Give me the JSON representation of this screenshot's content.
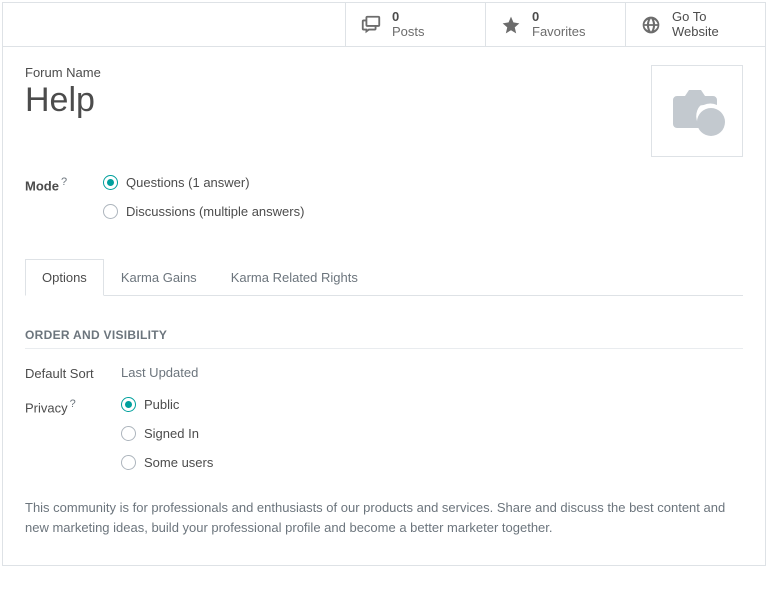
{
  "topbar": {
    "posts": {
      "count": "0",
      "label": "Posts"
    },
    "favorites": {
      "count": "0",
      "label": "Favorites"
    },
    "website": {
      "line1": "Go To",
      "line2": "Website"
    }
  },
  "title": {
    "field_label": "Forum Name",
    "value": "Help"
  },
  "mode": {
    "label": "Mode",
    "help": "?",
    "options": [
      {
        "label": "Questions (1 answer)",
        "checked": true
      },
      {
        "label": "Discussions (multiple answers)",
        "checked": false
      }
    ]
  },
  "tabs": [
    {
      "label": "Options",
      "active": true
    },
    {
      "label": "Karma Gains",
      "active": false
    },
    {
      "label": "Karma Related Rights",
      "active": false
    }
  ],
  "section1": {
    "heading": "ORDER AND VISIBILITY",
    "default_sort": {
      "label": "Default Sort",
      "value": "Last Updated"
    },
    "privacy": {
      "label": "Privacy",
      "help": "?",
      "options": [
        {
          "label": "Public",
          "checked": true
        },
        {
          "label": "Signed In",
          "checked": false
        },
        {
          "label": "Some users",
          "checked": false
        }
      ]
    }
  },
  "description": "This community is for professionals and enthusiasts of our products and services. Share and discuss the best content and new marketing ideas, build your professional profile and become a better marketer together."
}
